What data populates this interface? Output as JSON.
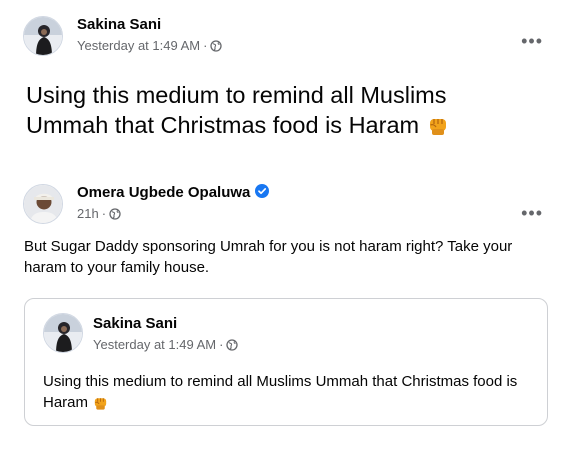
{
  "post1": {
    "author": "Sakina Sani",
    "time": "Yesterday at 1:49 AM",
    "separator": "·",
    "audience_icon": "globe-icon",
    "text": "Using this medium to remind all Muslims Ummah that Christmas food is Haram",
    "emoji": "raised-fist-emoji"
  },
  "post2": {
    "author": "Omera Ugbede Opaluwa",
    "verified_icon": "verified-badge-icon",
    "time": "21h",
    "separator": "·",
    "audience_icon": "globe-icon",
    "text": "But Sugar Daddy sponsoring Umrah for you is not haram right? Take your haram to your family house.",
    "shared": {
      "author": "Sakina Sani",
      "time": "Yesterday at 1:49 AM",
      "separator": "·",
      "audience_icon": "globe-icon",
      "text": "Using this medium to remind all Muslims Ummah that Christmas food is Haram",
      "emoji": "raised-fist-emoji"
    }
  },
  "more_label": "•••",
  "colors": {
    "name": "#050505",
    "meta": "#65676b",
    "verified": "#1877f2",
    "card_border": "#ced0d4",
    "emoji": "#f2a31b"
  }
}
